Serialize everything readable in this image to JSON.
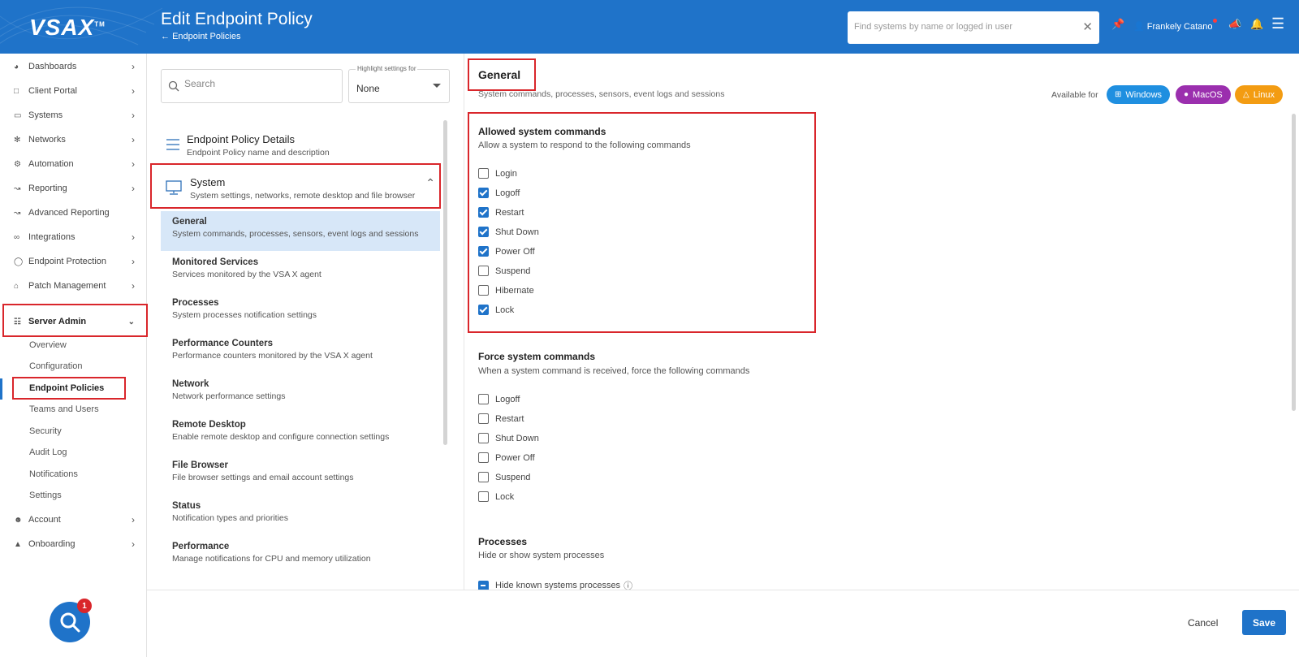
{
  "header": {
    "logo": "VSAX",
    "logo_tm": "TM",
    "title": "Edit Endpoint Policy",
    "breadcrumb": "Endpoint Policies",
    "search_placeholder": "Find systems by name or logged in user",
    "user_name": "Frankely Catano",
    "brand_color": "#1f73c9"
  },
  "sidebar": {
    "items": [
      {
        "label": "Dashboards",
        "icon": "gauge-icon"
      },
      {
        "label": "Client Portal",
        "icon": "window-icon"
      },
      {
        "label": "Systems",
        "icon": "monitor-icon"
      },
      {
        "label": "Networks",
        "icon": "network-icon"
      },
      {
        "label": "Automation",
        "icon": "gears-icon"
      },
      {
        "label": "Reporting",
        "icon": "chart-icon"
      },
      {
        "label": "Advanced Reporting",
        "icon": "chart-icon"
      },
      {
        "label": "Integrations",
        "icon": "infinity-icon"
      },
      {
        "label": "Endpoint Protection",
        "icon": "shield-icon"
      },
      {
        "label": "Patch Management",
        "icon": "home-gear-icon"
      },
      {
        "label": "Server Admin",
        "icon": "sitemap-icon"
      },
      {
        "label": "Account",
        "icon": "user-icon"
      },
      {
        "label": "Onboarding",
        "icon": "graduation-icon"
      }
    ],
    "server_admin_sub": [
      "Overview",
      "Configuration",
      "Endpoint Policies",
      "Teams and Users",
      "Security",
      "Audit Log",
      "Notifications",
      "Settings"
    ],
    "help_badge": "1"
  },
  "middle": {
    "search_placeholder": "Search",
    "highlight_label": "Highlight settings for",
    "highlight_value": "None",
    "details_title": "Endpoint Policy Details",
    "details_desc": "Endpoint Policy name and description",
    "system_title": "System",
    "system_desc": "System settings, networks, remote desktop and file browser",
    "items": [
      {
        "title": "General",
        "desc": "System commands, processes, sensors, event logs and sessions"
      },
      {
        "title": "Monitored Services",
        "desc": "Services monitored by the VSA X agent"
      },
      {
        "title": "Processes",
        "desc": "System processes notification settings"
      },
      {
        "title": "Performance Counters",
        "desc": "Performance counters monitored by the VSA X agent"
      },
      {
        "title": "Network",
        "desc": "Network performance settings"
      },
      {
        "title": "Remote Desktop",
        "desc": "Enable remote desktop and configure connection settings"
      },
      {
        "title": "File Browser",
        "desc": "File browser settings and email account settings"
      },
      {
        "title": "Status",
        "desc": "Notification types and priorities"
      },
      {
        "title": "Performance",
        "desc": "Manage notifications for CPU and memory utilization"
      }
    ]
  },
  "general": {
    "title": "General",
    "desc": "System commands, processes, sensors, event logs and sessions",
    "available_label": "Available for",
    "os": [
      {
        "label": "Windows",
        "color": "#1f8fe0"
      },
      {
        "label": "MacOS",
        "color": "#9b2fae"
      },
      {
        "label": "Linux",
        "color": "#f39c12"
      }
    ],
    "allowed_title": "Allowed system commands",
    "allowed_desc": "Allow a system to respond to the following commands",
    "allowed": [
      {
        "label": "Login",
        "checked": false
      },
      {
        "label": "Logoff",
        "checked": true
      },
      {
        "label": "Restart",
        "checked": true
      },
      {
        "label": "Shut Down",
        "checked": true
      },
      {
        "label": "Power Off",
        "checked": true
      },
      {
        "label": "Suspend",
        "checked": false
      },
      {
        "label": "Hibernate",
        "checked": false
      },
      {
        "label": "Lock",
        "checked": true
      }
    ],
    "force_title": "Force system commands",
    "force_desc": "When a system command is received, force the following commands",
    "force": [
      {
        "label": "Logoff",
        "checked": false
      },
      {
        "label": "Restart",
        "checked": false
      },
      {
        "label": "Shut Down",
        "checked": false
      },
      {
        "label": "Power Off",
        "checked": false
      },
      {
        "label": "Suspend",
        "checked": false
      },
      {
        "label": "Lock",
        "checked": false
      }
    ],
    "processes_title": "Processes",
    "processes_desc": "Hide or show system processes",
    "hide_known_label": "Hide known systems processes"
  },
  "footer": {
    "cancel": "Cancel",
    "save": "Save"
  }
}
